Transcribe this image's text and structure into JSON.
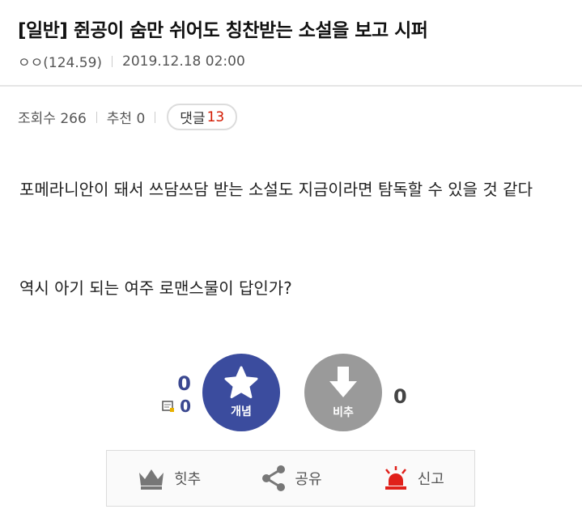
{
  "post": {
    "title": "[일반] 쥔공이 숨만 쉬어도 칭찬받는 소설을 보고 시퍼",
    "author": "ㅇㅇ(124.59)",
    "date": "2019.12.18 02:00"
  },
  "stats": {
    "views_label": "조회수 266",
    "recommend_label": "추천 0",
    "comment_label": "댓글",
    "comment_count": "13"
  },
  "content": {
    "paragraph1": "포메라니안이 돼서 쓰담쓰담 받는 소설도 지금이라면 탐독할 수 있을 것 같다",
    "paragraph2": "역시 아기 되는 여주 로맨스물이 답인가?"
  },
  "votes": {
    "up_count": "0",
    "fix_count": "0",
    "up_label": "개념",
    "down_label": "비추",
    "down_count": "0"
  },
  "actions": {
    "hit_label": "힛추",
    "share_label": "공유",
    "report_label": "신고"
  },
  "colors": {
    "up_button": "#3b4c9e",
    "down_button": "#9a9a9a",
    "comment_count": "#d31900",
    "report_icon": "#e0201a"
  },
  "icons": [
    "star-icon",
    "down-arrow-icon",
    "crown-icon",
    "share-icon",
    "siren-icon",
    "fix-icon"
  ]
}
